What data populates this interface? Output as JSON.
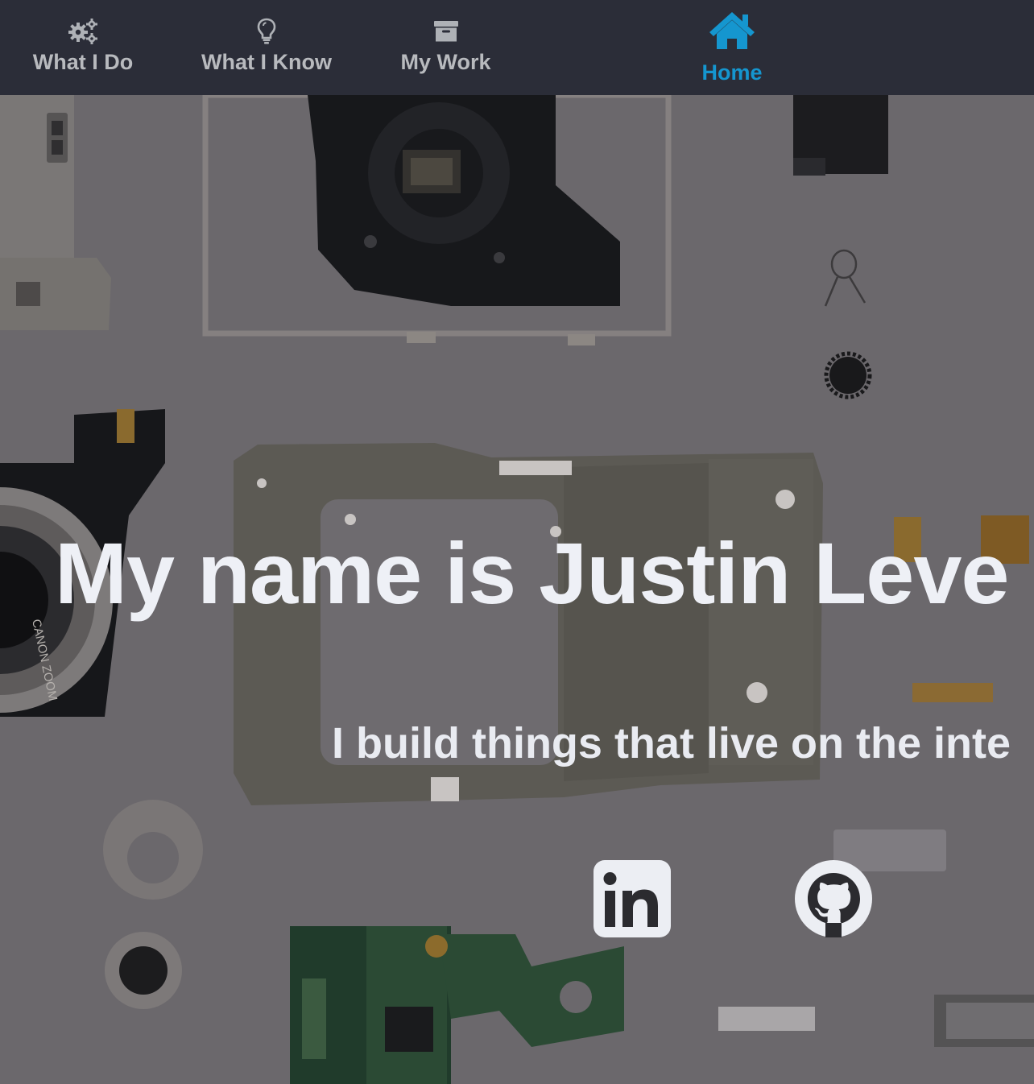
{
  "nav": {
    "items": [
      {
        "label": "What I Do",
        "icon": "gears-icon",
        "active": false
      },
      {
        "label": "What I Know",
        "icon": "lightbulb-icon",
        "active": false
      },
      {
        "label": "My Work",
        "icon": "archive-icon",
        "active": false
      },
      {
        "label": "Home",
        "icon": "home-icon",
        "active": true
      }
    ]
  },
  "hero": {
    "title": "My name is Justin Leve",
    "subtitle": "I build things that live on the inte"
  },
  "social": {
    "linkedin_icon": "linkedin-icon",
    "github_icon": "github-icon"
  },
  "colors": {
    "nav_bg": "#2b2d38",
    "nav_text": "#b8babe",
    "active": "#1596cf",
    "hero_text": "#eef0f6"
  }
}
